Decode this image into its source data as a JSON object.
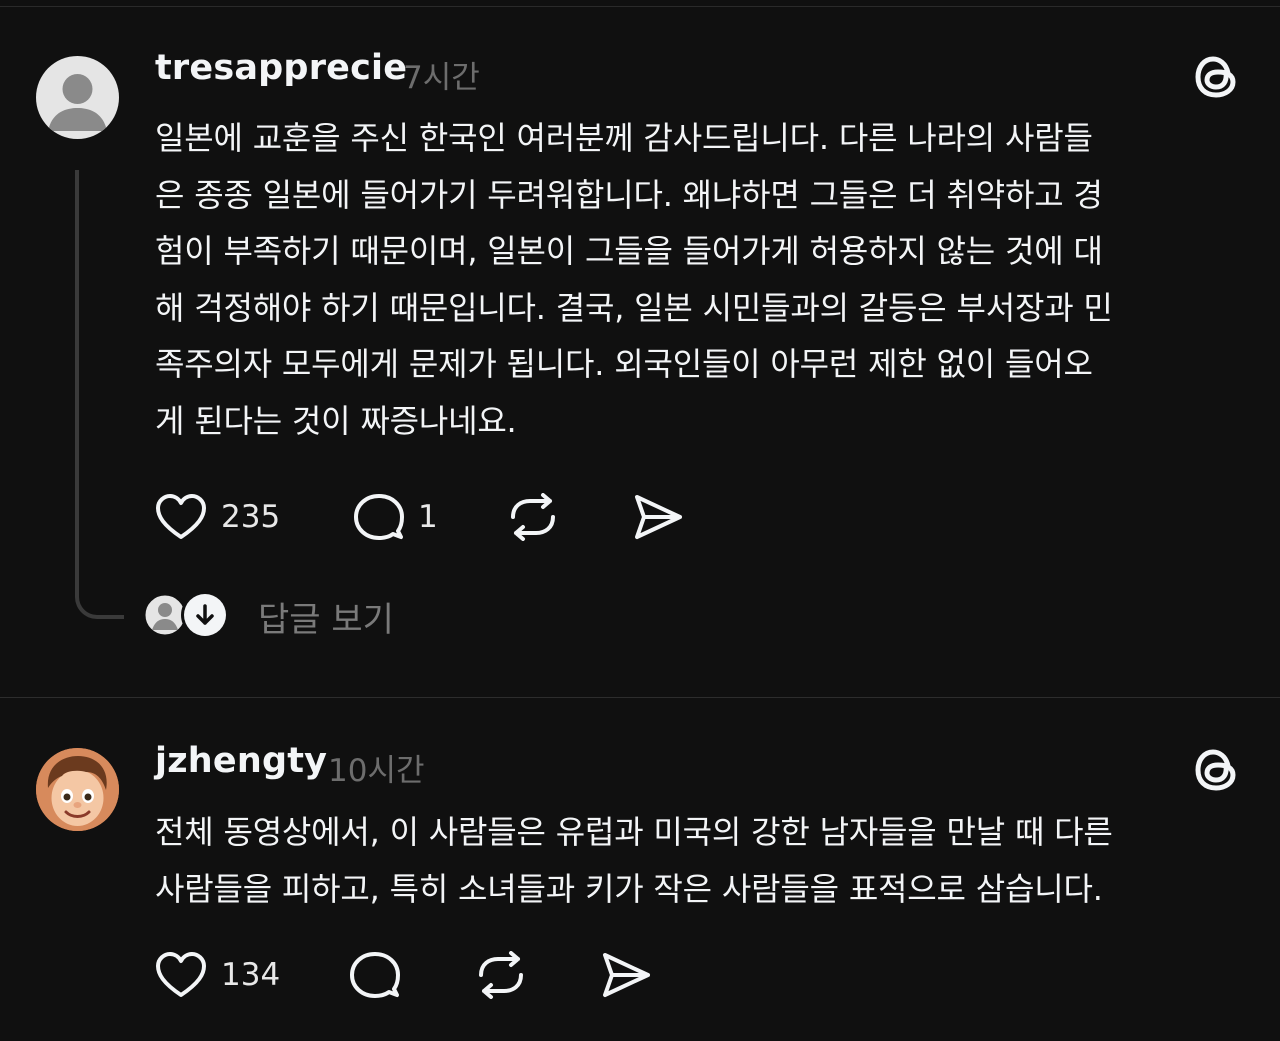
{
  "posts": [
    {
      "username": "tresapprecie",
      "time": "7시간",
      "body": "일본에 교훈을 주신 한국인 여러분께 감사드립니다. 다른 나라의 사람들\n은 종종 일본에 들어가기 두려워합니다. 왜냐하면 그들은 더 취약하고 경\n험이 부족하기 때문이며, 일본이 그들을 들어가게 허용하지 않는 것에 대\n해 걱정해야 하기 때문입니다. 결국, 일본 시민들과의 갈등은 부서장과 민\n족주의자 모두에게 문제가 됩니다. 외국인들이 아무런 제한 없이 들어오\n게 된다는 것이 짜증나네요.",
      "likes": "235",
      "replies": "1",
      "view_replies": "답글 보기"
    },
    {
      "username": "jzhengty",
      "time": "10시간",
      "body": "전체 동영상에서, 이 사람들은 유럽과 미국의 강한 남자들을 만날 때 다른\n사람들을 피하고, 특히 소녀들과 키가 작은 사람들을 표적으로 삼습니다.",
      "likes": "134"
    }
  ],
  "icons": [
    "threads-logo-icon",
    "heart-icon",
    "comment-icon",
    "repost-icon",
    "share-icon",
    "arrow-down-icon"
  ]
}
